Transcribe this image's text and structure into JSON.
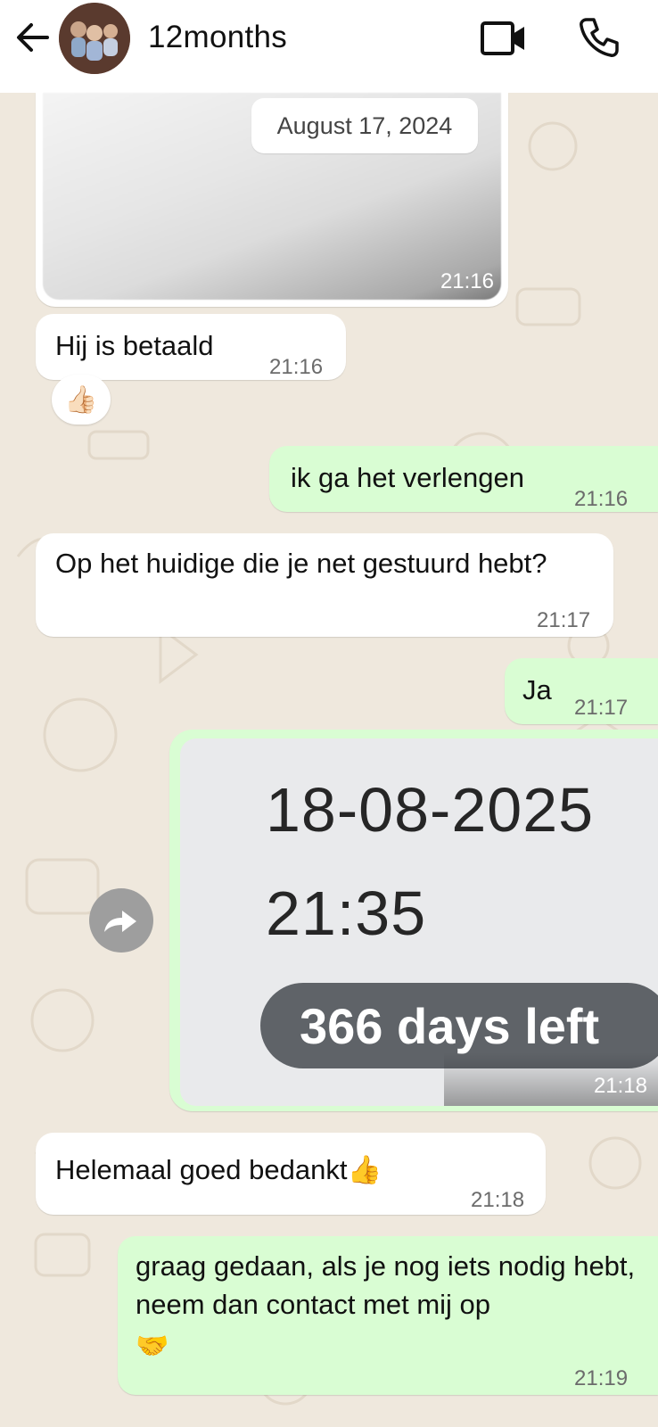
{
  "header": {
    "contact_name": "12months",
    "back_icon": "arrow-left-icon",
    "video_icon": "video-camera-icon",
    "call_icon": "phone-icon"
  },
  "date_separator": "August 17, 2024",
  "messages": [
    {
      "type": "image",
      "direction": "in",
      "time": "21:16"
    },
    {
      "type": "text",
      "direction": "in",
      "text": "Hij is betaald",
      "time": "21:16",
      "reaction": "👍🏻"
    },
    {
      "type": "text",
      "direction": "out",
      "text": "ik ga het verlengen",
      "time": "21:16"
    },
    {
      "type": "text",
      "direction": "in",
      "text": "Op het huidige die je net gestuurd hebt?",
      "time": "21:17"
    },
    {
      "type": "text",
      "direction": "out",
      "text": "Ja",
      "time": "21:17"
    },
    {
      "type": "screenshot",
      "direction": "out",
      "time": "21:18",
      "content": {
        "date": "18-08-2025",
        "clock": "21:35",
        "badge": "366 days left"
      }
    },
    {
      "type": "text",
      "direction": "in",
      "text": "Helemaal goed bedankt👍",
      "time": "21:18"
    },
    {
      "type": "text",
      "direction": "out",
      "text": "graag gedaan, als je nog iets nodig hebt, neem dan contact met mij op",
      "emoji": "🤝",
      "time": "21:19"
    }
  ],
  "colors": {
    "incoming_bubble": "#ffffff",
    "outgoing_bubble": "#d9fdd3",
    "wallpaper": "#efe8dd",
    "header": "#ffffff"
  }
}
